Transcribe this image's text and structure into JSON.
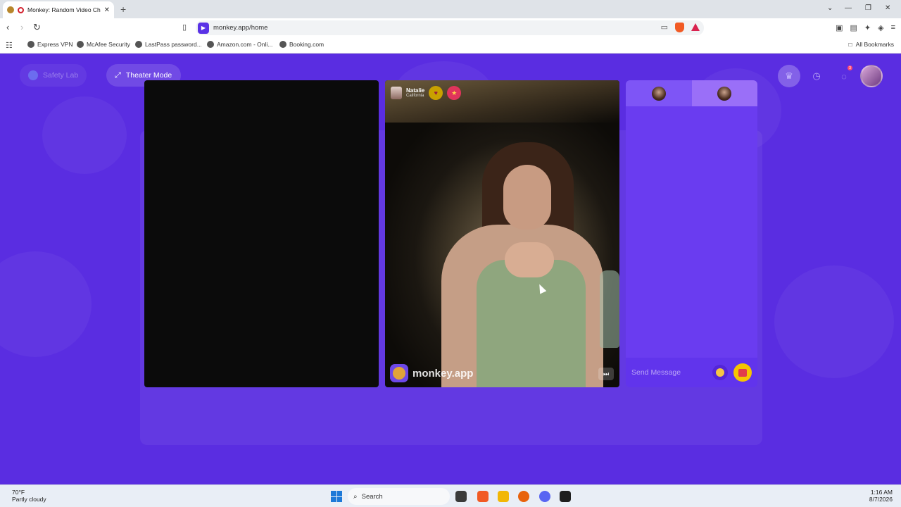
{
  "browser": {
    "tab_title": "Monkey: Random Video Chat",
    "tab_close": "✕",
    "new_tab": "+",
    "window_controls": {
      "dropdown": "⌄",
      "minimize": "—",
      "restore": "❐",
      "close": "✕"
    },
    "url": "monkey.app/home",
    "bookmarks": [
      {
        "label": "Express VPN"
      },
      {
        "label": "McAfee Security"
      },
      {
        "label": "LastPass password..."
      },
      {
        "label": "Amazon.com - Onli..."
      },
      {
        "label": "Booking.com"
      }
    ],
    "all_bookmarks": "All Bookmarks"
  },
  "page": {
    "safety_lab": "Safety Lab",
    "theater_mode": "Theater Mode",
    "notification_count": "3",
    "caller": {
      "name": "Natalie",
      "location": "California"
    },
    "watermark": "monkey.app",
    "chat": {
      "placeholder": "Send Message"
    }
  },
  "taskbar": {
    "weather_temp": "70°F",
    "weather_desc": "Partly cloudy",
    "search_label": "Search",
    "time": "1:16 AM",
    "date": "8/7/2026"
  },
  "colors": {
    "page_bg": "#5a2de1",
    "chat_panel": "#6a3cf0",
    "accent_yellow": "#f6c400",
    "brave_orange": "#f15a24"
  },
  "icons": {
    "back": "back-arrow-icon",
    "forward": "forward-arrow-icon",
    "reload": "reload-icon",
    "crown": "crown-icon",
    "history": "clock-icon",
    "messages": "chat-bubble-icon",
    "emoji": "emoji-icon",
    "gift": "gift-icon",
    "skip": "skip-icon"
  }
}
